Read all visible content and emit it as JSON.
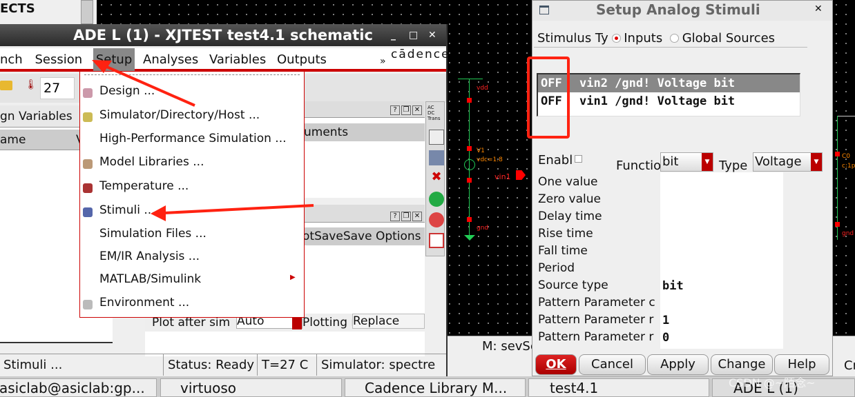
{
  "bg_window": {
    "text": "ECTS"
  },
  "ade": {
    "title": "ADE L (1) - XJTEST test4.1 schematic",
    "menu": [
      "nch",
      "Session",
      "Setup",
      "Analyses",
      "Variables",
      "Outputs"
    ],
    "brand": "cādence",
    "more": "»",
    "temperature": "27",
    "left_pane_title": "gn Variables",
    "left_col_header": "ame",
    "left_col_header2": "V",
    "analyses_header": "uments",
    "outputs_headers": [
      "ot",
      "Save",
      "Save Options"
    ],
    "plot_after_sim_label": "Plot after sim",
    "plot_after_sim_value": "Auto",
    "plotting_mode_label": "Plotting r",
    "plotting_mode_value": "Replace",
    "radio_labels": [
      "AC",
      "DC",
      "Trans"
    ],
    "status": {
      "hint": "Stimuli ...",
      "status": "Status: Ready",
      "temp": "T=27  C",
      "simulator": "Simulator: spectre"
    }
  },
  "setup_menu": {
    "items": [
      {
        "label": "Design ...",
        "icon": "design-icon"
      },
      {
        "label": "Simulator/Directory/Host ...",
        "icon": "simulator-icon"
      },
      {
        "label": "High-Performance Simulation ...",
        "icon": ""
      },
      {
        "label": "Model Libraries ...",
        "icon": "model-library-icon"
      },
      {
        "label": "Temperature ...",
        "icon": "thermometer-icon"
      },
      {
        "label": "Stimuli ...",
        "icon": "stimuli-icon"
      },
      {
        "label": "Simulation Files ...",
        "icon": ""
      },
      {
        "label": "EM/IR Analysis ...",
        "icon": ""
      },
      {
        "label": "MATLAB/Simulink",
        "icon": "",
        "submenu": true
      },
      {
        "label": "Environment ...",
        "icon": "environment-icon"
      }
    ]
  },
  "dialog": {
    "title": "Setup Analog Stimuli",
    "stimulus_type_label": "Stimulus Ty",
    "radio_inputs": "Inputs",
    "radio_global": "Global Sources",
    "stimuli_list": [
      {
        "state": "OFF",
        "desc": "vin2 /gnd! Voltage bit",
        "selected": true
      },
      {
        "state": "OFF",
        "desc": "vin1 /gnd! Voltage bit",
        "selected": false
      }
    ],
    "enable_label": "Enabl",
    "enabled": false,
    "function_label": "Functio",
    "function_value": "bit",
    "type_label": "Type",
    "type_value": "Voltage",
    "params": [
      {
        "label": "One value",
        "value": ""
      },
      {
        "label": "Zero value",
        "value": ""
      },
      {
        "label": "Delay time",
        "value": ""
      },
      {
        "label": "Rise time",
        "value": ""
      },
      {
        "label": "Fall time",
        "value": ""
      },
      {
        "label": "Period",
        "value": ""
      },
      {
        "label": "Source type",
        "value": "bit"
      },
      {
        "label": "Pattern Parameter c",
        "value": ""
      },
      {
        "label": "Pattern Parameter r",
        "value": "1"
      },
      {
        "label": "Pattern Parameter r",
        "value": "0"
      }
    ],
    "buttons": [
      "OK",
      "Cancel",
      "Apply",
      "Change",
      "Help"
    ]
  },
  "schematic": {
    "labels": [
      "vdd",
      "V1",
      "vdc=1.8",
      "vin1",
      "gnd",
      "C0",
      "c:1p",
      "gnd"
    ],
    "status": "M: sevSe",
    "right_text": "Cr"
  },
  "taskbar": [
    "asiclab@asiclab:gp...",
    "virtuoso",
    "Cadence Library M...",
    "test4.1",
    "ADE L (1)"
  ],
  "watermark": "CSDN @~陌念~",
  "colors": {
    "accent": "#cc0000",
    "annotation": "#ff2020",
    "wire": "#22cc55"
  }
}
